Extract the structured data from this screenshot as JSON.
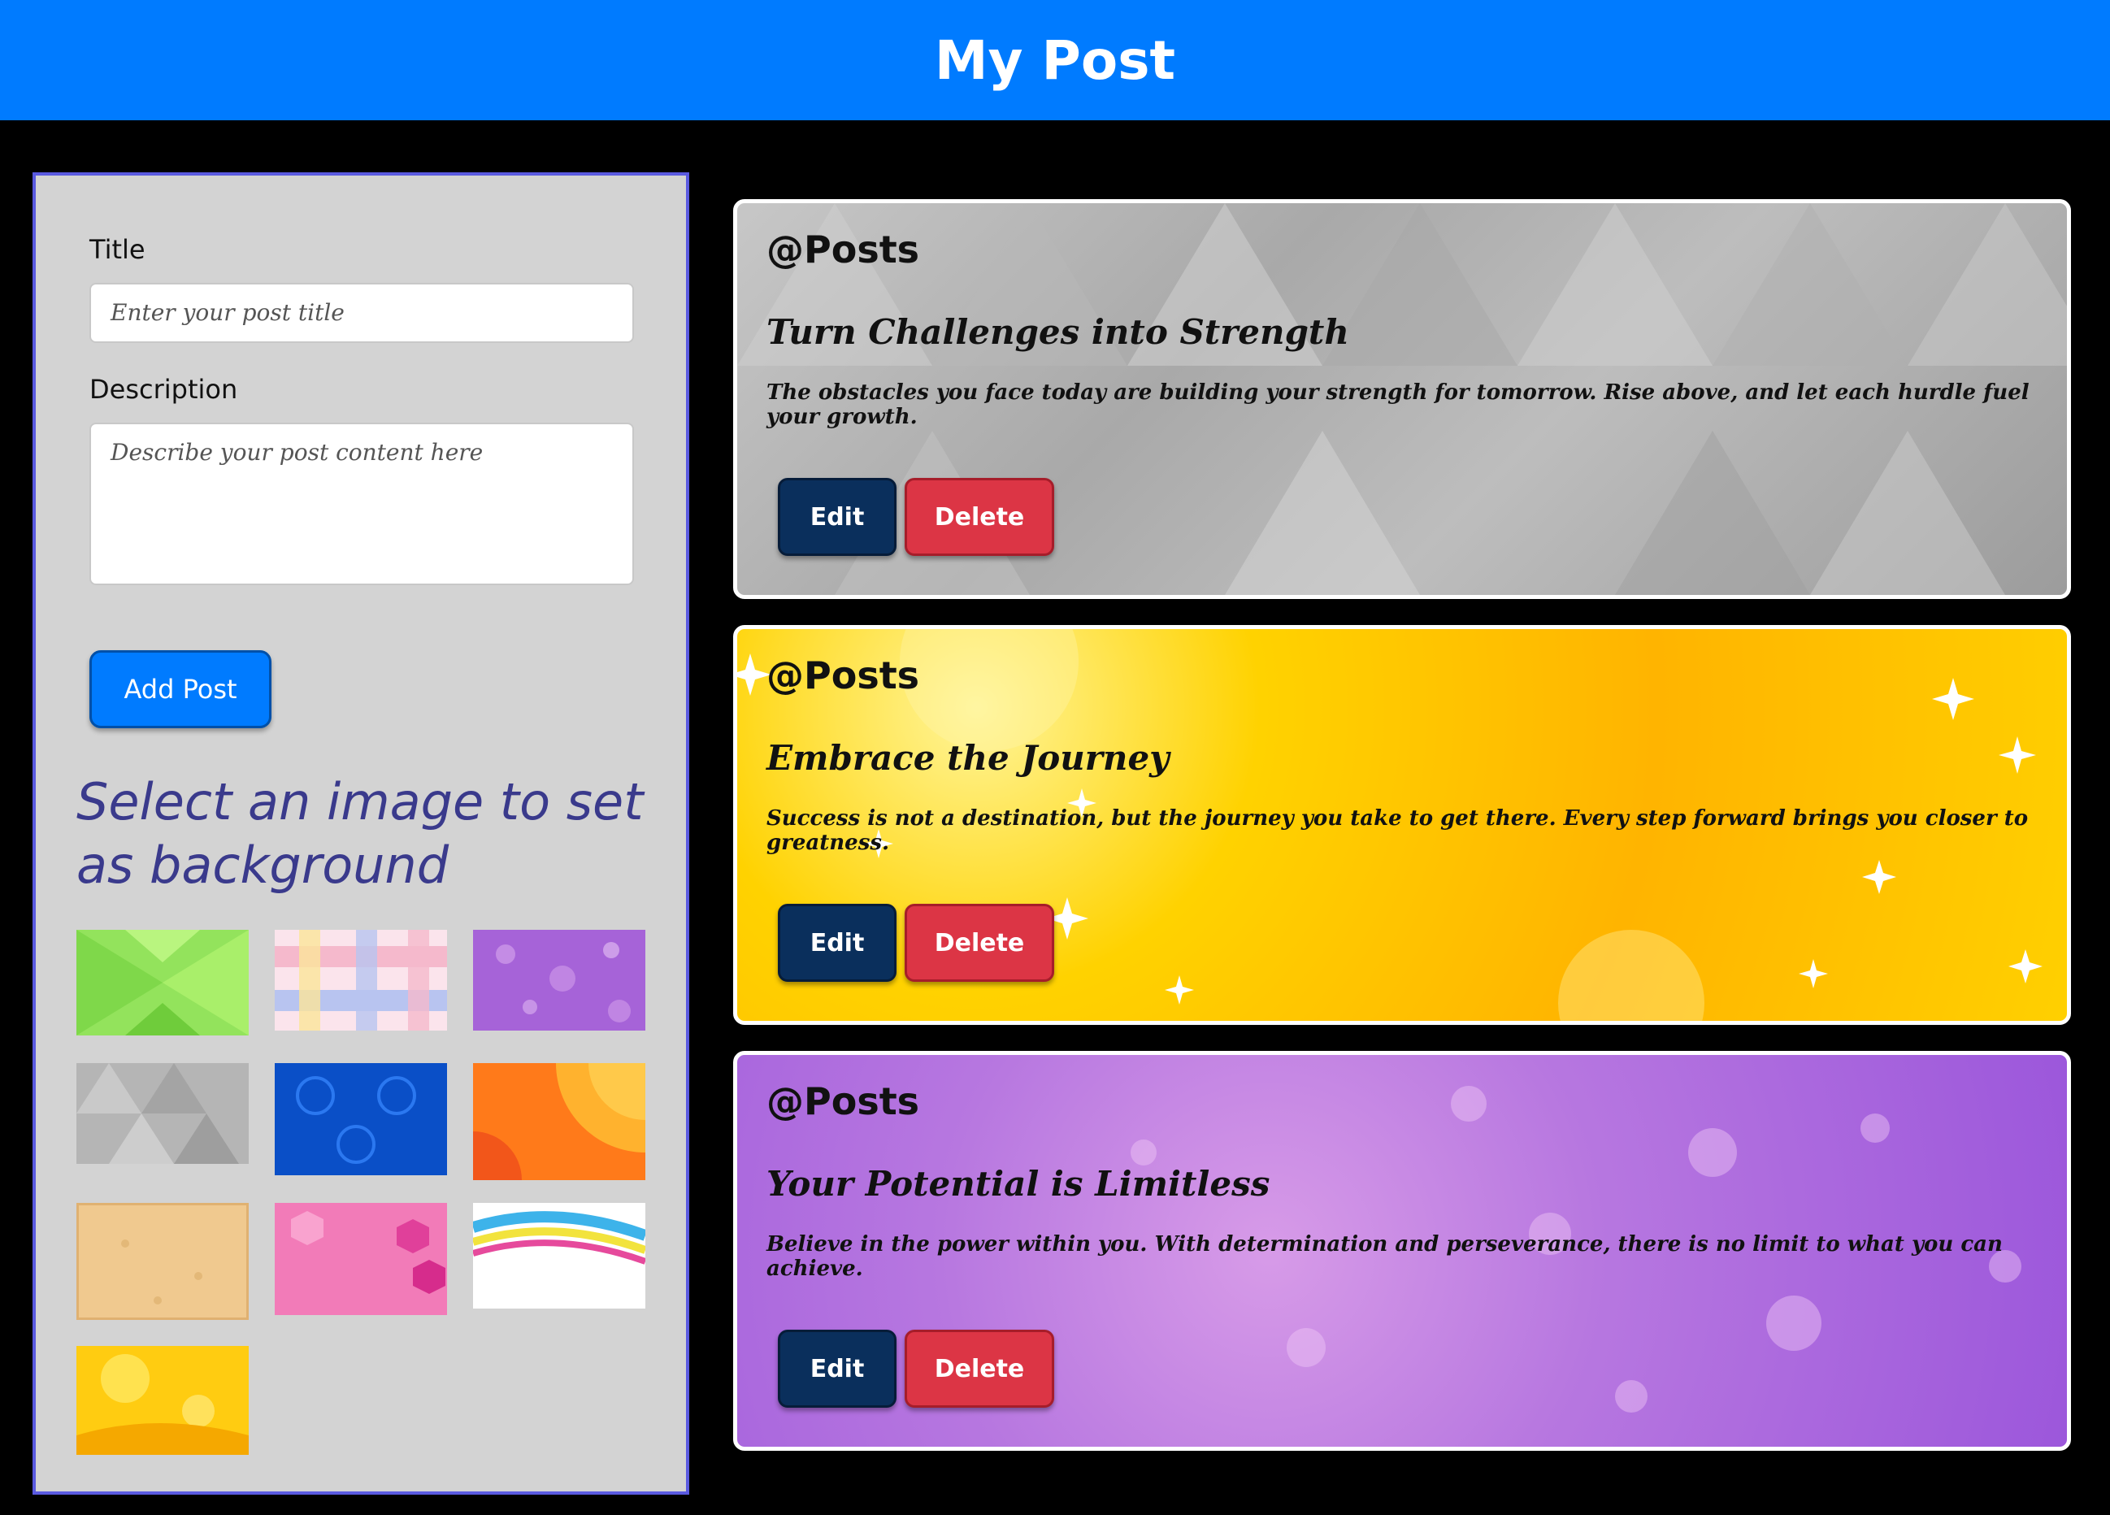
{
  "header": {
    "title": "My Post"
  },
  "form": {
    "title_label": "Title",
    "title_placeholder": "Enter your post title",
    "description_label": "Description",
    "description_placeholder": "Describe your post content here",
    "add_button": "Add Post"
  },
  "background_picker": {
    "heading": "Select an image to set as background",
    "images": [
      "green-pattern",
      "pastel-plaid",
      "purple-bokeh",
      "gray-triangles",
      "blue-damask",
      "orange-waves",
      "beige-texture",
      "pink-hexagons",
      "rainbow-wave",
      "yellow-sparkle"
    ]
  },
  "posts": [
    {
      "user": "@Posts",
      "title": "Turn Challenges into Strength",
      "body": "The obstacles you face today are building your strength for tomorrow. Rise above, and let each hurdle fuel your growth.",
      "edit_label": "Edit",
      "delete_label": "Delete",
      "background": "gray-triangles"
    },
    {
      "user": "@Posts",
      "title": "Embrace the Journey",
      "body": "Success is not a destination, but the journey you take to get there. Every step forward brings you closer to greatness.",
      "edit_label": "Edit",
      "delete_label": "Delete",
      "background": "yellow-sparkle"
    },
    {
      "user": "@Posts",
      "title": "Your Potential is Limitless",
      "body": "Believe in the power within you. With determination and perseverance, there is no limit to what you can achieve.",
      "edit_label": "Edit",
      "delete_label": "Delete",
      "background": "purple-bokeh"
    }
  ],
  "colors": {
    "header": "#007bff",
    "panel": "#d3d3d3",
    "panel_border": "#5a5ae0",
    "edit_button": "#0a2f5c",
    "delete_button": "#dc3545",
    "heading_text": "#3a3a8c"
  }
}
